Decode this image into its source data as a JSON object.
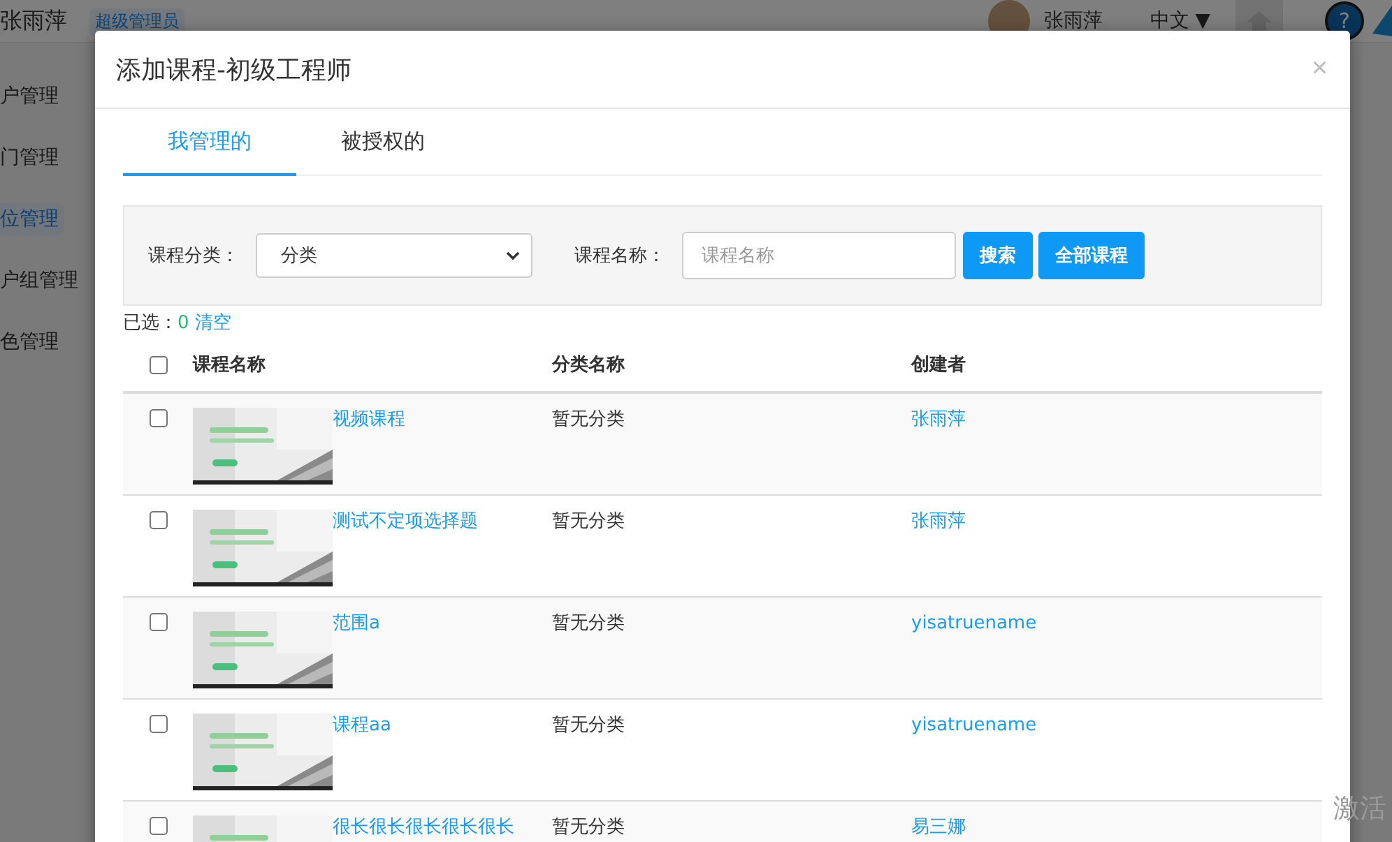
{
  "header": {
    "user_name": "张雨萍",
    "role_badge": "超级管理员",
    "account_name": "张雨萍",
    "language": "中文 ▼",
    "help": "?"
  },
  "sidebar": {
    "items": [
      {
        "label": "户管理",
        "selected": false
      },
      {
        "label": "门管理",
        "selected": false
      },
      {
        "label": "位管理",
        "selected": true
      },
      {
        "label": "户组管理",
        "selected": false
      },
      {
        "label": "色管理",
        "selected": false
      }
    ]
  },
  "modal": {
    "title": "添加课程-初级工程师",
    "close": "×",
    "tabs": [
      {
        "label": "我管理的",
        "selected": true
      },
      {
        "label": "被授权的",
        "selected": false
      }
    ],
    "filters": {
      "category_label": "课程分类：",
      "category_value": "分类",
      "name_label": "课程名称：",
      "name_placeholder": "课程名称",
      "search_button": "搜索",
      "all_button": "全部课程"
    },
    "selection": {
      "label": "已选：",
      "count": "0",
      "clear": "清空"
    },
    "table": {
      "columns": [
        "课程名称",
        "分类名称",
        "创建者"
      ],
      "header_checked": false,
      "rows": [
        {
          "title": "视频课程",
          "category": "暂无分类",
          "creator": "张雨萍",
          "checked": false
        },
        {
          "title": "测试不定项选择题",
          "category": "暂无分类",
          "creator": "张雨萍",
          "checked": false
        },
        {
          "title": "范围a",
          "category": "暂无分类",
          "creator": "yisatruename",
          "checked": false
        },
        {
          "title": "课程aa",
          "category": "暂无分类",
          "creator": "yisatruename",
          "checked": false
        },
        {
          "title": "很长很长很长很长很长",
          "category": "暂无分类",
          "creator": "易三娜",
          "checked": false
        }
      ]
    }
  },
  "system_notice": "激活"
}
